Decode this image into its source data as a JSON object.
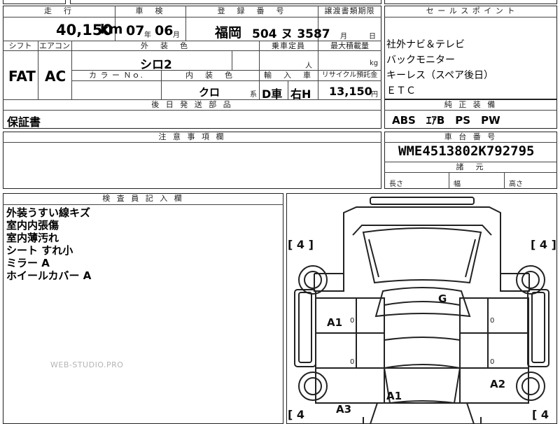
{
  "top": {
    "mileage_label": "走　行",
    "mileage_value": "40,150",
    "mileage_unit": "km",
    "inspection_label": "車　検",
    "inspection_year": "07",
    "inspection_year_unit": "年",
    "inspection_month": "06",
    "inspection_month_unit": "月",
    "reg_label": "登　録　番　号",
    "reg_region": "福岡",
    "reg_number": "504 ヌ 3587",
    "transfer_label": "譲渡書類期限",
    "transfer_month": "月",
    "transfer_day": "日"
  },
  "row2": {
    "shift_label": "シフト",
    "shift_value": "FAT",
    "aircon_label": "エアコン",
    "aircon_value": "AC",
    "exterior_label": "外　装　色",
    "exterior_value": "シロ2",
    "capacity_label": "乗車定員",
    "capacity_unit": "人",
    "load_label": "最大積載量",
    "load_unit": "kg",
    "colorno_label": "カ ラ ー Ｎｏ.",
    "interior_label": "内　装　色",
    "interior_value": "クロ",
    "interior_unit": "系",
    "import_label": "輸　入　車",
    "import_type": "D車",
    "import_side": "右H",
    "recycle_label": "リサイクル預託金",
    "recycle_value": "13,150",
    "recycle_unit": "円"
  },
  "sales": {
    "label": "セ ー ル ス ポ イ ン ト",
    "lines": [
      "社外ナビ＆テレビ",
      "バックモニター",
      "キーレス（スペア後日）",
      "ＥＴＣ"
    ]
  },
  "equipment": {
    "label": "純 正 装 備",
    "value": "ABS　ｴｱB　PS　PW"
  },
  "later": {
    "label": "後 日 発 送 部 品",
    "value": "保証書"
  },
  "caution": {
    "label": "注 意 事 項 欄"
  },
  "chassis": {
    "label": "車 台 番 号",
    "value": "WME4513802K792795"
  },
  "dims": {
    "label": "諸　元",
    "length": "長さ",
    "width": "幅",
    "height": "高さ"
  },
  "inspector": {
    "label": "検 査 員 記 入 欄",
    "notes": [
      "外装うすい線キズ",
      "室内内張傷",
      "室内薄汚れ",
      "シート すれ小",
      "ミラー A",
      "ホイールカバー A"
    ]
  },
  "watermark": "WEB-STUDIO.PRO",
  "diagram": {
    "tire_tl": "[ 4 ]",
    "tire_tr": "[ 4 ]",
    "tire_bl": "[ 4",
    "tire_br": "[ 4",
    "mark_g": "G",
    "mark_a1_door": "A1",
    "mark_a2": "A2",
    "mark_a1_rear": "A1",
    "mark_a3": "A3",
    "zero": "0"
  }
}
